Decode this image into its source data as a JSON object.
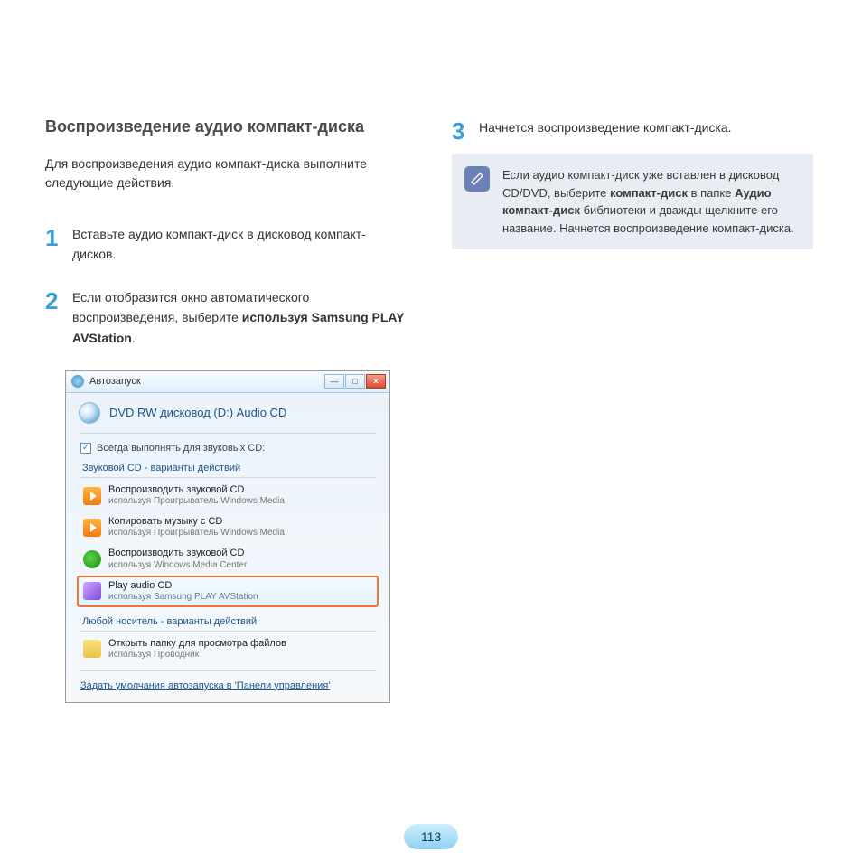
{
  "left": {
    "title": "Воспроизведение аудио компакт-диска",
    "intro": "Для воспроизведения аудио компакт-диска выполните следующие действия.",
    "step1_num": "1",
    "step1_text": "Вставьте аудио компакт-диск в дисковод компакт-дисков.",
    "step2_num": "2",
    "step2_pre": "Если отобразится окно автоматического воспроизведения, выберите ",
    "step2_bold": "используя Samsung PLAY AVStation",
    "step2_post": "."
  },
  "autoplay": {
    "title": "Автозапуск",
    "drive_label": "DVD RW дисковод (D:) Audio CD",
    "always_label": "Всегда выполнять для звуковых CD:",
    "group1": "Звуковой CD - варианты действий",
    "opts": [
      {
        "title": "Воспроизводить звуковой CD",
        "sub": "используя Проигрыватель Windows Media",
        "icon": "play"
      },
      {
        "title": "Копировать музыку с CD",
        "sub": "используя Проигрыватель Windows Media",
        "icon": "play"
      },
      {
        "title": "Воспроизводить звуковой CD",
        "sub": "используя Windows Media Center",
        "icon": "mc"
      },
      {
        "title": "Play audio CD",
        "sub": "используя Samsung PLAY AVStation",
        "icon": "samsung",
        "hl": true
      }
    ],
    "group2": "Любой носитель - варианты действий",
    "opts2": [
      {
        "title": "Открыть папку для просмотра файлов",
        "sub": "используя Проводник",
        "icon": "folder"
      }
    ],
    "link": "Задать умолчания автозапуска в 'Панели управления'"
  },
  "right": {
    "step3_num": "3",
    "step3_text": "Начнется воспроизведение компакт-диска.",
    "note_pre": "Если аудио компакт-диск уже вставлен в дисковод CD/DVD, выберите ",
    "note_b1": "компакт-диск",
    "note_mid1": " в папке ",
    "note_b2": "Аудио компакт-диск",
    "note_mid2": " библиотеки и дважды щелкните его название. Начнется воспроизведение компакт-диска."
  },
  "page_number": "113"
}
